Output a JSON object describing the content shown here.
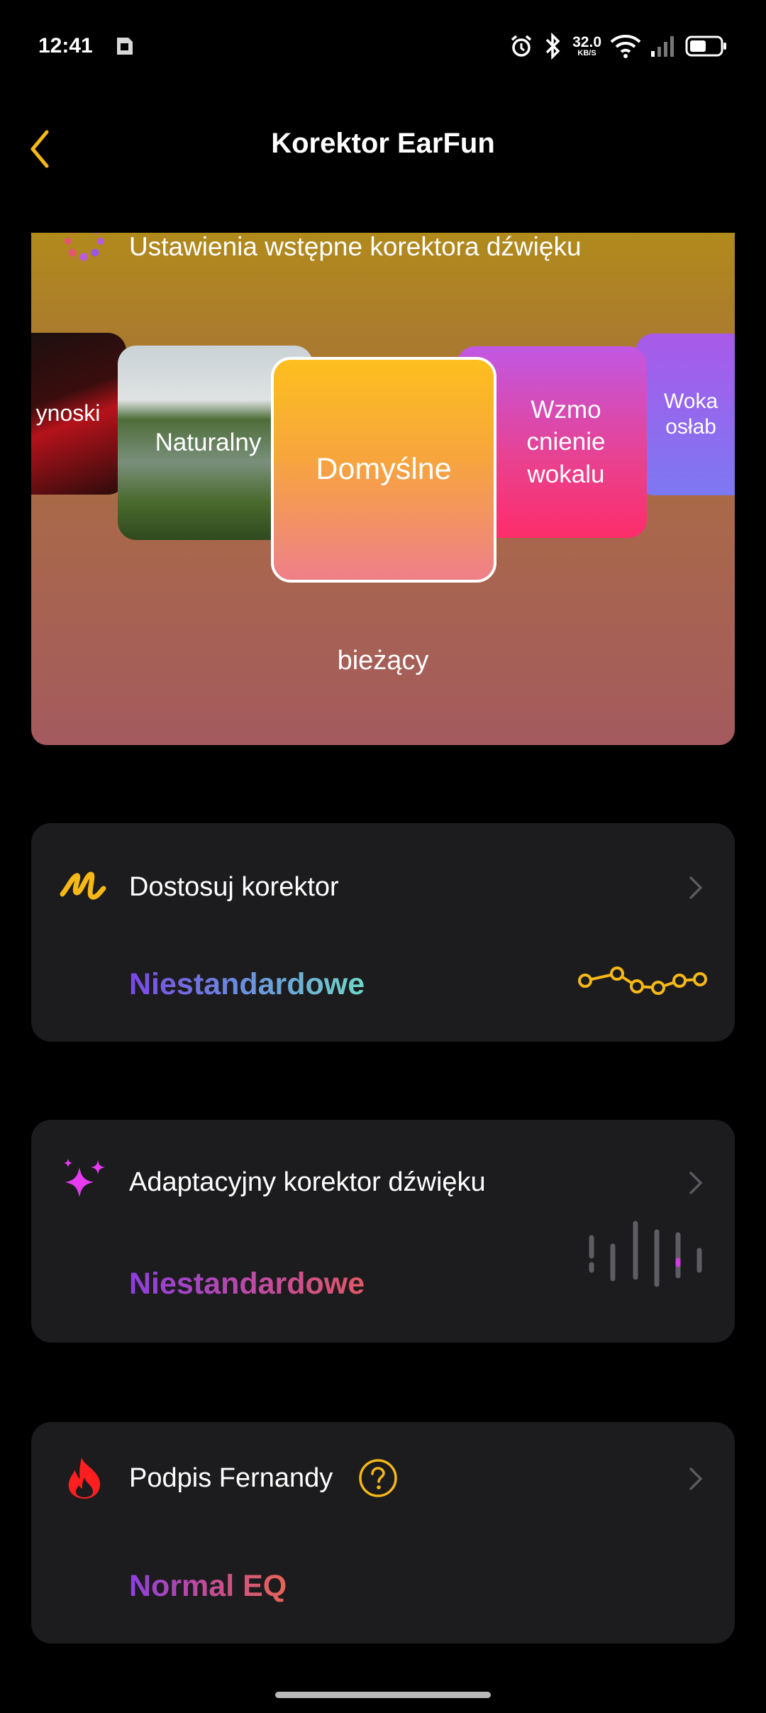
{
  "status_bar": {
    "time": "12:41",
    "net_speed_value": "32.0",
    "net_speed_unit": "KB/S",
    "icons": [
      "sim-card-icon",
      "alarm-icon",
      "bluetooth-icon",
      "wifi-icon",
      "signal-icon",
      "battery-icon"
    ]
  },
  "header": {
    "title": "Korektor EarFun",
    "back_icon": "chevron-left-icon"
  },
  "presets": {
    "title": "Ustawienia wstępne korektora dźwięku",
    "tiles": [
      {
        "label": "ynoski"
      },
      {
        "label": "Naturalny"
      },
      {
        "label": "Domyślne",
        "selected": true
      },
      {
        "label": "Wzmo\ncnienie\nwokalu"
      },
      {
        "label": "Woka\nosłab"
      }
    ],
    "current_label": "bieżący"
  },
  "custom_eq": {
    "title": "Dostosuj korektor",
    "value": "Niestandardowe",
    "icon": "squiggle-icon"
  },
  "adaptive_eq": {
    "title": "Adaptacyjny korektor dźwięku",
    "value": "Niestandardowe",
    "icon": "sparkle-icon"
  },
  "signature": {
    "title": "Podpis Fernandy",
    "value": "Normal EQ",
    "icon": "fire-icon"
  },
  "colors": {
    "accent": "#F5B816",
    "card_bg": "#1C1C1E",
    "background": "#000000"
  }
}
